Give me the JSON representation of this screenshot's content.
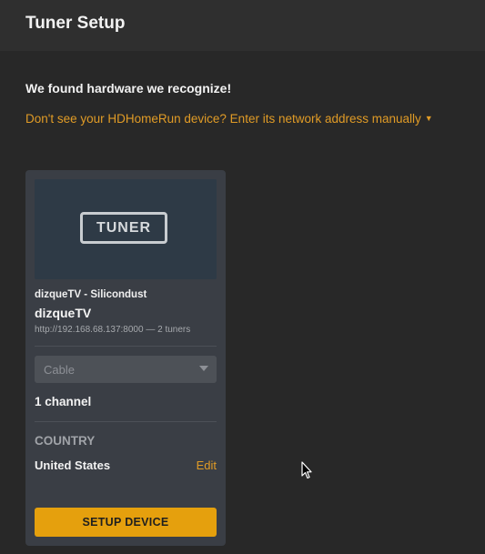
{
  "header": {
    "title": "Tuner Setup"
  },
  "main": {
    "found_message": "We found hardware we recognize!",
    "manual_link": "Don't see your HDHomeRun device? Enter its network address manually",
    "manual_link_icon": "caret-down-icon"
  },
  "device_card": {
    "image_label": "TUNER",
    "provider": "dizqueTV - Silicondust",
    "name": "dizqueTV",
    "url_info": "http://192.168.68.137:8000 — 2 tuners",
    "source_select": {
      "selected": "Cable",
      "icon": "chevron-down-icon"
    },
    "channel_count": "1 channel",
    "country_label": "COUNTRY",
    "country_value": "United States",
    "edit_label": "Edit",
    "setup_button_label": "SETUP DEVICE"
  },
  "colors": {
    "accent": "#e5a00d",
    "link": "#e09b26",
    "background": "#282828",
    "card": "#3a3e45"
  }
}
